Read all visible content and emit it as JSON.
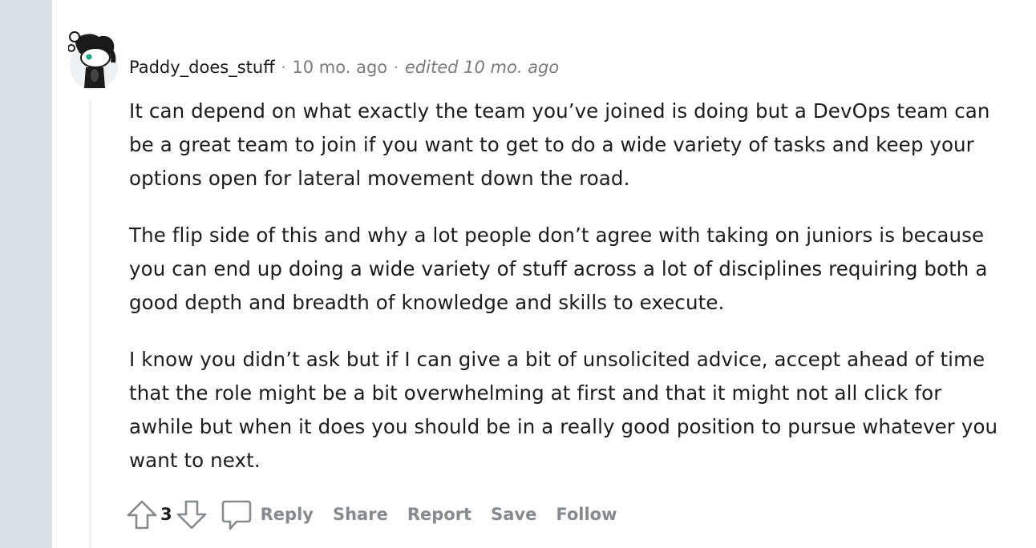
{
  "comment": {
    "username": "Paddy_does_stuff",
    "separator": "·",
    "time_ago": "10 mo. ago",
    "edited_label": "edited 10 mo. ago",
    "paragraphs": [
      "It can depend on what exactly the team you’ve joined is doing but a DevOps team can be a great team to join if you want to get to do a wide variety of tasks and keep your options open for lateral movement down the road.",
      "The flip side of this and why a lot people don’t agree with taking on juniors is because you can end up doing a wide variety of stuff across a lot of disciplines requiring both a good depth and breadth of knowledge and skills to execute.",
      "I know you didn’t ask but if I can give a bit of unsolicited advice, accept ahead of time that the role might be a bit overwhelming at first and that it might not all click for awhile but when it does you should be in a really good position to pursue whatever you want to next."
    ],
    "score": "3",
    "actions": {
      "reply": "Reply",
      "share": "Share",
      "report": "Report",
      "save": "Save",
      "follow": "Follow"
    }
  },
  "icons": {
    "avatar": "snoo-avatar-icon",
    "upvote": "upvote-arrow-icon",
    "downvote": "downvote-arrow-icon",
    "comment": "speech-bubble-icon"
  },
  "colors": {
    "rail": "#dae0e6",
    "text": "#1c1c1c",
    "muted": "#7c7c7c",
    "action": "#878a8c",
    "thread_line": "#edeff1",
    "avatar_eye": "#14a37f"
  }
}
